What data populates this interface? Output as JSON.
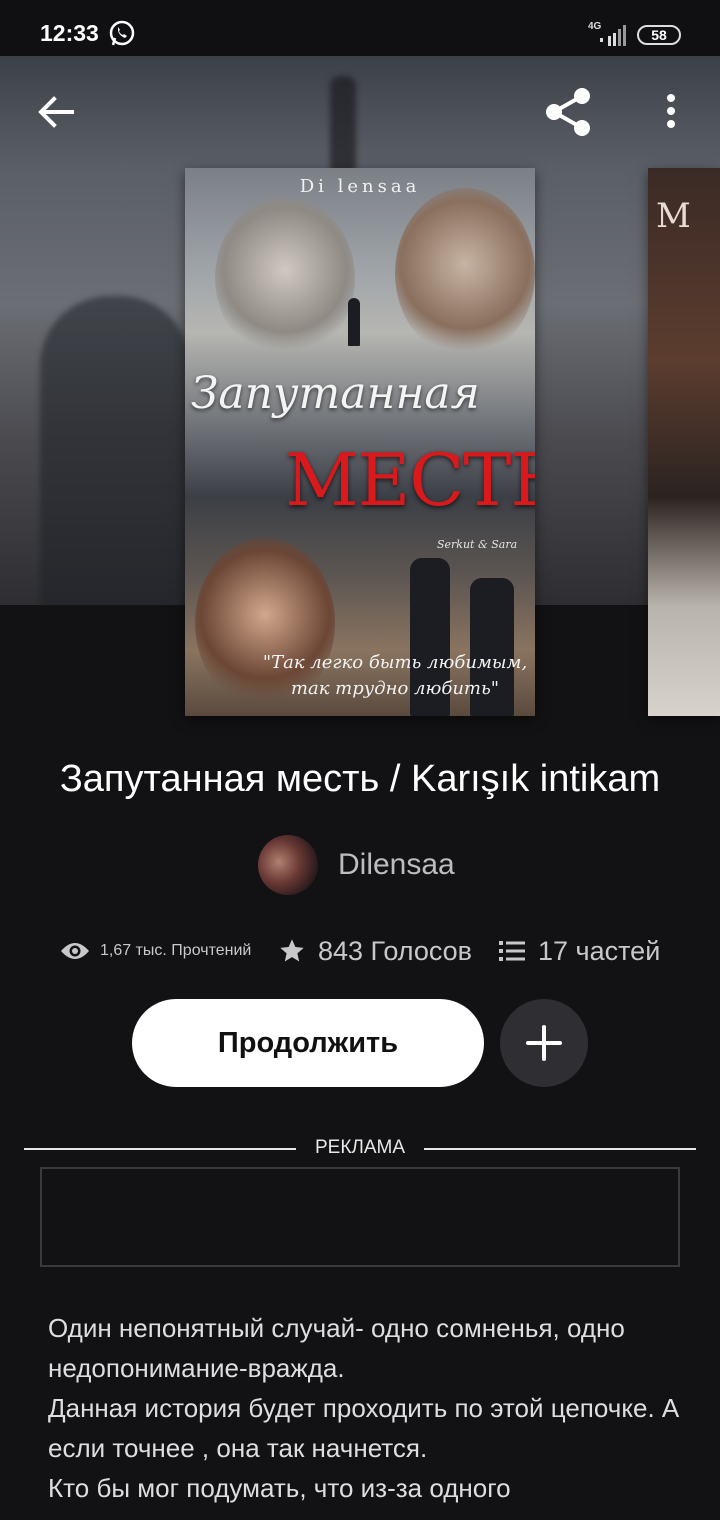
{
  "status_bar": {
    "time": "12:33",
    "network": "4G",
    "battery": "58",
    "icons": [
      "whatsapp-icon",
      "signal-icon",
      "battery-icon"
    ]
  },
  "toolbar": {
    "icons": [
      "back-arrow-icon",
      "share-icon",
      "more-vertical-icon"
    ]
  },
  "cover": {
    "author": "Di lensaa",
    "title_line1": "Запутанная",
    "title_line2": "МЕСТЬ",
    "names": "Serkut & Sara",
    "quote": "\"Так легко быть любимым, так трудно любить\""
  },
  "story": {
    "title": "Запутанная месть / Karışık intikam",
    "author": "Dilensaa",
    "reads": "1,67 тыс. Прочтений",
    "votes": "843 Голосов",
    "parts": "17 частей"
  },
  "actions": {
    "continue_label": "Продолжить"
  },
  "ad": {
    "label": "РЕКЛАМА"
  },
  "description": "Один непонятный случай- одно сомненья, одно недопонимание-вражда.\nДанная история будет проходить по этой цепочке. А если точнее , она так начнется.\nКто бы мог подумать, что из-за одного",
  "colors": {
    "background": "#121214",
    "accent_red": "#d9191b",
    "button_bg": "#ffffff",
    "add_button_bg": "#2f2f33"
  }
}
